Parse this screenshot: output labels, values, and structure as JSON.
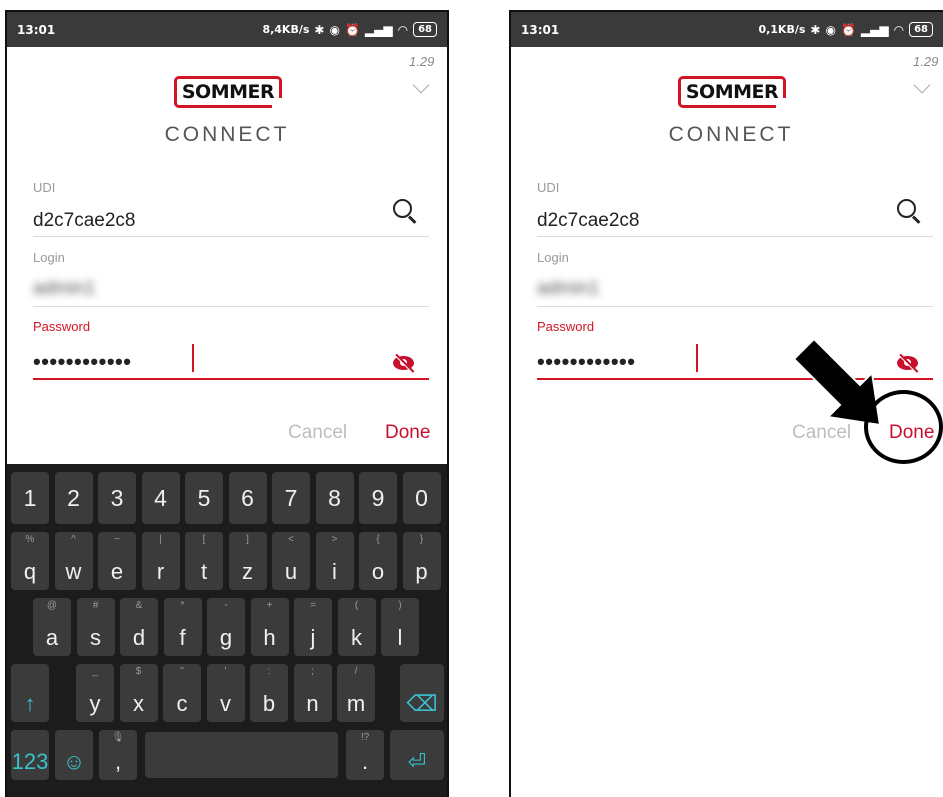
{
  "screens": [
    {
      "status": {
        "time": "13:01",
        "net_speed": "8,4KB/s",
        "battery": "68"
      },
      "version": "1.29",
      "logo_text": "SOMMER",
      "app_subtitle": "CONNECT",
      "udi": {
        "label": "UDI",
        "value": "d2c7cae2c8"
      },
      "login": {
        "label": "Login",
        "value": "admin1"
      },
      "password": {
        "label": "Password",
        "masked": "••••••••••••"
      },
      "cancel_label": "Cancel",
      "done_label": "Done"
    },
    {
      "status": {
        "time": "13:01",
        "net_speed": "0,1KB/s",
        "battery": "68"
      },
      "version": "1.29",
      "logo_text": "SOMMER",
      "app_subtitle": "CONNECT",
      "udi": {
        "label": "UDI",
        "value": "d2c7cae2c8"
      },
      "login": {
        "label": "Login",
        "value": "admin1"
      },
      "password": {
        "label": "Password",
        "masked": "••••••••••••"
      },
      "cancel_label": "Cancel",
      "done_label": "Done"
    }
  ],
  "keyboard": {
    "number_row": [
      "1",
      "2",
      "3",
      "4",
      "5",
      "6",
      "7",
      "8",
      "9",
      "0"
    ],
    "row1": [
      {
        "key": "q",
        "alt": "%"
      },
      {
        "key": "w",
        "alt": "^"
      },
      {
        "key": "e",
        "alt": "~"
      },
      {
        "key": "r",
        "alt": "|"
      },
      {
        "key": "t",
        "alt": "["
      },
      {
        "key": "z",
        "alt": "]"
      },
      {
        "key": "u",
        "alt": "<"
      },
      {
        "key": "i",
        "alt": ">"
      },
      {
        "key": "o",
        "alt": "{"
      },
      {
        "key": "p",
        "alt": "}"
      }
    ],
    "row2": [
      {
        "key": "a",
        "alt": "@"
      },
      {
        "key": "s",
        "alt": "#"
      },
      {
        "key": "d",
        "alt": "&"
      },
      {
        "key": "f",
        "alt": "*"
      },
      {
        "key": "g",
        "alt": "-"
      },
      {
        "key": "h",
        "alt": "+"
      },
      {
        "key": "j",
        "alt": "="
      },
      {
        "key": "k",
        "alt": "("
      },
      {
        "key": "l",
        "alt": ")"
      }
    ],
    "row3": [
      {
        "key": "y",
        "alt": "_"
      },
      {
        "key": "x",
        "alt": "$"
      },
      {
        "key": "c",
        "alt": "\""
      },
      {
        "key": "v",
        "alt": "'"
      },
      {
        "key": "b",
        "alt": ":"
      },
      {
        "key": "n",
        "alt": ";"
      },
      {
        "key": "m",
        "alt": "/"
      }
    ],
    "shift_icon": "↑",
    "backspace_icon": "⌫",
    "mode_key": "123",
    "emoji_icon": "☺",
    "comma_key": ",",
    "period_key": ".",
    "period_alt": "!?",
    "enter_icon": "⏎"
  },
  "colors": {
    "accent": "#c8102e",
    "keyboard_bg": "#1c1c1c",
    "key_bg": "#3b3b3b",
    "fn_key": "#3ac0cf"
  }
}
